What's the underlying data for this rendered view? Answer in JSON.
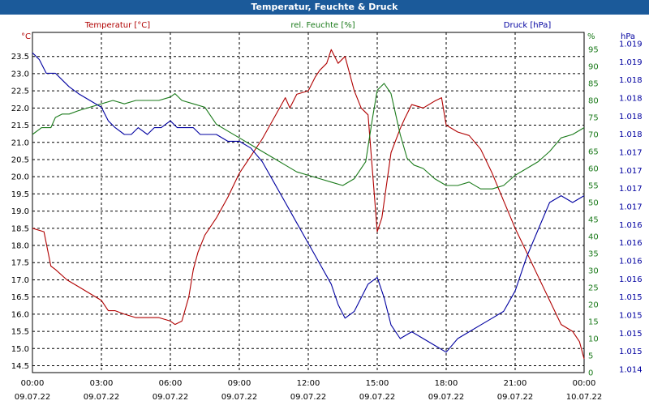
{
  "window": {
    "title": "Temperatur, Feuchte & Druck"
  },
  "colors": {
    "temperature": "#b00000",
    "humidity": "#1a7a1a",
    "pressure": "#0000a0",
    "grid": "#000000",
    "titlebar": "#1b5a9a"
  },
  "chart_data": {
    "type": "line",
    "title": "Temperatur, Feuchte & Druck",
    "grid": true,
    "x_ticks": [
      {
        "t": 0,
        "time": "00:00",
        "date": "09.07.22"
      },
      {
        "t": 3,
        "time": "03:00",
        "date": "09.07.22"
      },
      {
        "t": 6,
        "time": "06:00",
        "date": "09.07.22"
      },
      {
        "t": 9,
        "time": "09:00",
        "date": "09.07.22"
      },
      {
        "t": 12,
        "time": "12:00",
        "date": "09.07.22"
      },
      {
        "t": 15,
        "time": "15:00",
        "date": "09.07.22"
      },
      {
        "t": 18,
        "time": "18:00",
        "date": "09.07.22"
      },
      {
        "t": 21,
        "time": "21:00",
        "date": "09.07.22"
      },
      {
        "t": 24,
        "time": "00:00",
        "date": "10.07.22"
      }
    ],
    "axes": {
      "temperature": {
        "label": "Temperatur [°C]",
        "unit": "°C",
        "range": [
          14.3,
          24.2
        ],
        "ticks": [
          "14.5",
          "15.0",
          "15.5",
          "16.0",
          "16.5",
          "17.0",
          "17.5",
          "18.0",
          "18.5",
          "19.0",
          "19.5",
          "20.0",
          "20.5",
          "21.0",
          "21.5",
          "22.0",
          "22.5",
          "23.0",
          "23.5"
        ]
      },
      "humidity": {
        "label": "rel. Feuchte [%]",
        "unit": "%",
        "range": [
          0,
          100
        ],
        "ticks": [
          "0",
          "5",
          "10",
          "15",
          "20",
          "25",
          "30",
          "35",
          "40",
          "45",
          "50",
          "55",
          "60",
          "65",
          "70",
          "75",
          "80",
          "85",
          "90",
          "95"
        ]
      },
      "pressure": {
        "label": "Druck [hPa]",
        "unit": "hPa",
        "range": [
          1014.4,
          1019.4
        ],
        "ticks": [
          "1.014",
          "1.015",
          "1.015",
          "1.015",
          "1.015",
          "1.016",
          "1.016",
          "1.016",
          "1.016",
          "1.017",
          "1.017",
          "1.017",
          "1.017",
          "1.018",
          "1.018",
          "1.018",
          "1.018",
          "1.019",
          "1.019"
        ]
      }
    },
    "series": [
      {
        "name": "Temperatur [°C]",
        "axis": "temperature",
        "x": [
          0,
          0.5,
          0.8,
          1.0,
          1.5,
          2.0,
          2.5,
          3.0,
          3.3,
          3.6,
          4.0,
          4.5,
          5.0,
          5.5,
          6.0,
          6.2,
          6.5,
          6.8,
          7.0,
          7.2,
          7.5,
          8.0,
          8.5,
          9.0,
          9.5,
          10.0,
          10.5,
          11.0,
          11.2,
          11.5,
          12.0,
          12.3,
          12.5,
          12.8,
          13.0,
          13.3,
          13.6,
          14.0,
          14.3,
          14.6,
          15.0,
          15.2,
          15.6,
          16.0,
          16.2,
          16.5,
          17.0,
          17.5,
          17.8,
          18.0,
          18.5,
          19.0,
          19.5,
          20.0,
          20.5,
          21.0,
          21.5,
          22.0,
          22.5,
          23.0,
          23.5,
          23.8,
          24.0
        ],
        "values": [
          18.5,
          18.4,
          17.4,
          17.3,
          17.0,
          16.8,
          16.6,
          16.4,
          16.1,
          16.1,
          16.0,
          15.9,
          15.9,
          15.9,
          15.8,
          15.7,
          15.8,
          16.5,
          17.3,
          17.8,
          18.3,
          18.8,
          19.4,
          20.1,
          20.6,
          21.1,
          21.7,
          22.3,
          22.0,
          22.4,
          22.5,
          22.9,
          23.1,
          23.3,
          23.7,
          23.3,
          23.5,
          22.5,
          22.0,
          21.8,
          18.4,
          18.8,
          20.7,
          21.4,
          21.7,
          22.1,
          22.0,
          22.2,
          22.3,
          21.5,
          21.3,
          21.2,
          20.8,
          20.1,
          19.3,
          18.5,
          17.8,
          17.1,
          16.4,
          15.7,
          15.5,
          15.2,
          14.7
        ]
      },
      {
        "name": "rel. Feuchte [%]",
        "axis": "humidity",
        "x": [
          0,
          0.4,
          0.8,
          1.0,
          1.3,
          1.6,
          2.0,
          2.5,
          3.0,
          3.5,
          4.0,
          4.5,
          5.0,
          5.5,
          6.0,
          6.2,
          6.5,
          7.0,
          7.5,
          8.0,
          8.5,
          9.0,
          9.5,
          10.0,
          10.5,
          11.0,
          11.5,
          12.0,
          12.5,
          13.0,
          13.5,
          14.0,
          14.5,
          14.8,
          15.0,
          15.3,
          15.6,
          16.0,
          16.3,
          16.6,
          17.0,
          17.5,
          18.0,
          18.5,
          19.0,
          19.5,
          20.0,
          20.5,
          21.0,
          21.5,
          22.0,
          22.5,
          23.0,
          23.5,
          24.0
        ],
        "values": [
          70,
          72,
          72,
          75,
          76,
          76,
          77,
          78,
          79,
          80,
          79,
          80,
          80,
          80,
          81,
          82,
          80,
          79,
          78,
          73,
          71,
          69,
          67,
          65,
          63,
          61,
          59,
          58,
          57,
          56,
          55,
          57,
          62,
          75,
          83,
          85,
          82,
          70,
          63,
          61,
          60,
          57,
          55,
          55,
          56,
          54,
          54,
          55,
          58,
          60,
          62,
          65,
          69,
          70,
          72
        ]
      },
      {
        "name": "Druck [hPa]",
        "axis": "pressure",
        "x": [
          0,
          0.3,
          0.6,
          1.0,
          1.3,
          1.6,
          2.0,
          2.5,
          3.0,
          3.3,
          3.6,
          4.0,
          4.3,
          4.6,
          5.0,
          5.3,
          5.6,
          6.0,
          6.3,
          6.6,
          7.0,
          7.3,
          7.6,
          8.0,
          8.5,
          9.0,
          9.5,
          10.0,
          10.5,
          11.0,
          11.5,
          12.0,
          12.5,
          13.0,
          13.3,
          13.6,
          14.0,
          14.3,
          14.6,
          15.0,
          15.3,
          15.6,
          16.0,
          16.5,
          17.0,
          17.5,
          18.0,
          18.5,
          19.0,
          19.5,
          20.0,
          20.5,
          21.0,
          21.5,
          22.0,
          22.5,
          23.0,
          23.5,
          24.0
        ],
        "values": [
          1019.1,
          1019.0,
          1018.8,
          1018.8,
          1018.7,
          1018.6,
          1018.5,
          1018.4,
          1018.3,
          1018.1,
          1018.0,
          1017.9,
          1017.9,
          1018.0,
          1017.9,
          1018.0,
          1018.0,
          1018.1,
          1018.0,
          1018.0,
          1018.0,
          1017.9,
          1017.9,
          1017.9,
          1017.8,
          1017.8,
          1017.7,
          1017.5,
          1017.2,
          1016.9,
          1016.6,
          1016.3,
          1016.0,
          1015.7,
          1015.4,
          1015.2,
          1015.3,
          1015.5,
          1015.7,
          1015.8,
          1015.5,
          1015.1,
          1014.9,
          1015.0,
          1014.9,
          1014.8,
          1014.7,
          1014.9,
          1015.0,
          1015.1,
          1015.2,
          1015.3,
          1015.6,
          1016.1,
          1016.5,
          1016.9,
          1017.0,
          1016.9,
          1017.0
        ]
      }
    ]
  }
}
